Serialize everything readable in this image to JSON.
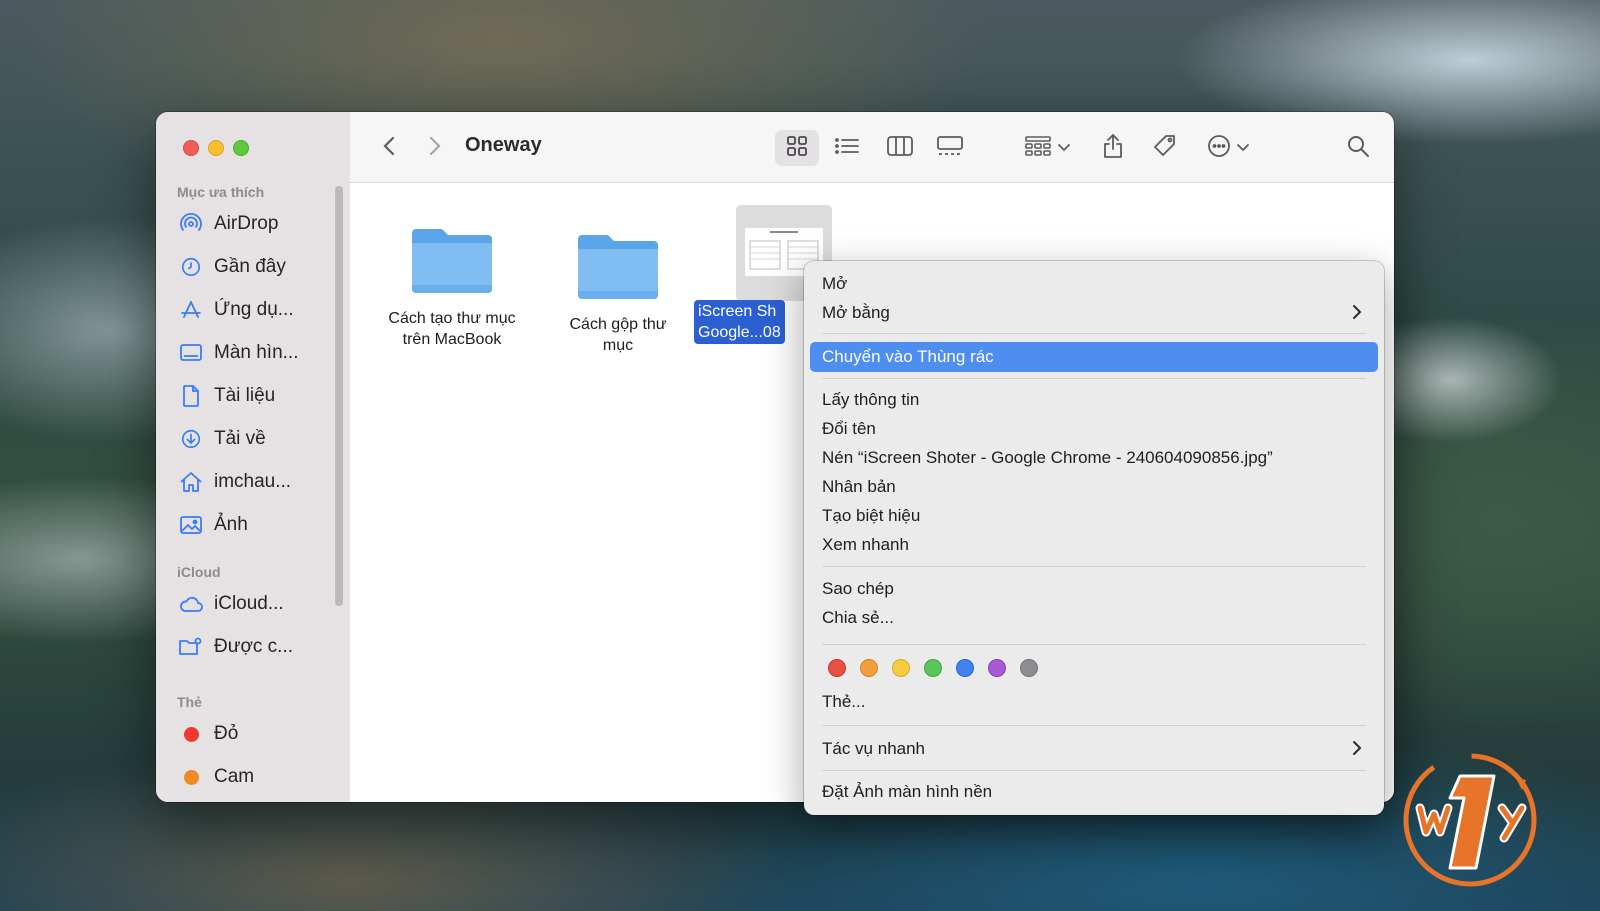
{
  "window": {
    "title": "Oneway"
  },
  "sidebar": {
    "favorites_header": "Mục ưa thích",
    "favorites": [
      {
        "label": "AirDrop",
        "icon": "airdrop-icon"
      },
      {
        "label": "Gần đây",
        "icon": "clock-icon"
      },
      {
        "label": "Ứng dụ...",
        "icon": "applications-icon"
      },
      {
        "label": "Màn hìn...",
        "icon": "desktop-icon"
      },
      {
        "label": "Tài liệu",
        "icon": "document-icon"
      },
      {
        "label": "Tải về",
        "icon": "download-icon"
      },
      {
        "label": "imchau...",
        "icon": "home-icon"
      },
      {
        "label": "Ảnh",
        "icon": "photo-icon"
      }
    ],
    "icloud_header": "iCloud",
    "icloud": [
      {
        "label": "iCloud...",
        "icon": "cloud-icon"
      },
      {
        "label": "Được c...",
        "icon": "shared-folder-icon"
      }
    ],
    "tags_header": "Thẻ",
    "tags": [
      {
        "label": "Đỏ",
        "color": "#ee3b30"
      },
      {
        "label": "Cam",
        "color": "#f08a24"
      }
    ]
  },
  "files": [
    {
      "line1": "Cách tạo thư mục",
      "line2": "trên MacBook",
      "type": "folder"
    },
    {
      "line1": "Cách gộp thư",
      "line2": "mục",
      "type": "folder"
    },
    {
      "line1": "iScreen Sh",
      "line2": "Google...08",
      "type": "image",
      "selected": true
    }
  ],
  "context_menu": {
    "open": "Mở",
    "open_with": "Mở bằng",
    "move_to_trash": "Chuyển vào Thùng rác",
    "get_info": "Lấy thông tin",
    "rename": "Đổi tên",
    "compress": "Nén “iScreen Shoter - Google Chrome - 240604090856.jpg”",
    "duplicate": "Nhân bản",
    "make_alias": "Tạo biệt hiệu",
    "quick_look": "Xem nhanh",
    "copy": "Sao chép",
    "share": "Chia sẻ...",
    "tag_colors": [
      "#ea4f43",
      "#f0a03a",
      "#f5cd3e",
      "#5ac659",
      "#3f82f0",
      "#a659d2",
      "#8e8e92"
    ],
    "tags": "Thẻ...",
    "quick_actions": "Tác vụ nhanh",
    "set_desktop": "Đặt Ảnh màn hình nền"
  },
  "accent": "#2c5fd2",
  "highlight": "#4d8ef0"
}
